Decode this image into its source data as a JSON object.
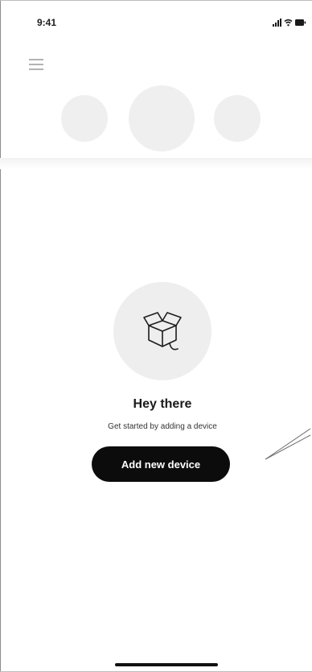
{
  "status_bar": {
    "time": "9:41"
  },
  "header": {
    "menu_icon": "hamburger-menu-icon",
    "carousel_placeholders": 3
  },
  "empty_state": {
    "illustration_icon": "open-box-icon",
    "title": "Hey there",
    "subtitle": "Get started by adding a device",
    "cta_label": "Add new device"
  },
  "colors": {
    "background": "#ffffff",
    "placeholder": "#efefef",
    "button": "#0c0c0c",
    "button_text": "#ffffff"
  }
}
